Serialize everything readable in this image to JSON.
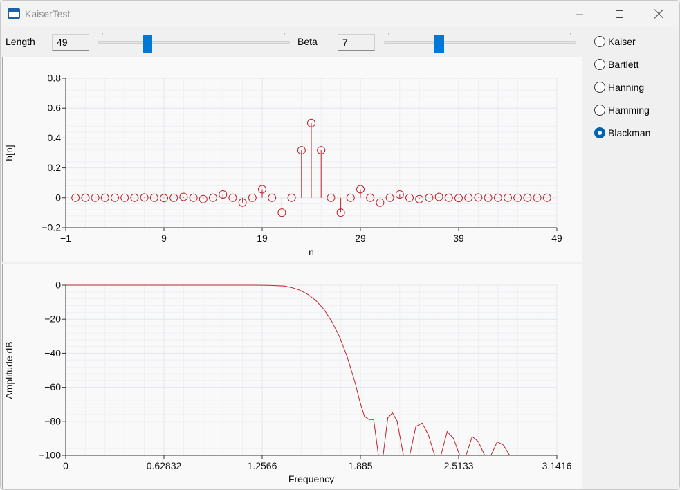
{
  "window": {
    "title": "KaiserTest"
  },
  "controls": {
    "length_label": "Length",
    "length_value": "49",
    "length_slider": {
      "min": 0,
      "max": 200,
      "value": 49
    },
    "beta_label": "Beta",
    "beta_value": "7",
    "beta_slider": {
      "min": 0,
      "max": 25,
      "value": 7
    }
  },
  "window_types": [
    {
      "label": "Kaiser",
      "selected": false
    },
    {
      "label": "Bartlett",
      "selected": false
    },
    {
      "label": "Hanning",
      "selected": false
    },
    {
      "label": "Hamming",
      "selected": false
    },
    {
      "label": "Blackman",
      "selected": true
    }
  ],
  "colors": {
    "accent": "#0078d7",
    "series": "#c0202a",
    "grid": "#e3e6ec",
    "panel": "#f9f9f9"
  },
  "chart_data": [
    {
      "type": "stem",
      "xlabel": "n",
      "ylabel": "h[n]",
      "xlim": [
        -1,
        49
      ],
      "ylim": [
        -0.2,
        0.8
      ],
      "xticks": [
        -1,
        9,
        19,
        29,
        39,
        49
      ],
      "xtick_labels": [
        "−1",
        "9",
        "19",
        "29",
        "39",
        "49"
      ],
      "yticks": [
        0.8,
        0.6,
        0.4,
        0.2,
        0,
        -0.2
      ],
      "ytick_labels": [
        "0.8",
        "0.6",
        "0.4",
        "0.2",
        "0",
        "−0.2"
      ],
      "grid": true,
      "x": [
        0,
        1,
        2,
        3,
        4,
        5,
        6,
        7,
        8,
        9,
        10,
        11,
        12,
        13,
        14,
        15,
        16,
        17,
        18,
        19,
        20,
        21,
        22,
        23,
        24,
        25,
        26,
        27,
        28,
        29,
        30,
        31,
        32,
        33,
        34,
        35,
        36,
        37,
        38,
        39,
        40,
        41,
        42,
        43,
        44,
        45,
        46,
        47,
        48
      ],
      "values": [
        0,
        0,
        0,
        0,
        0,
        0,
        0,
        0.002,
        0,
        -0.002,
        0,
        0.006,
        0,
        -0.009,
        0,
        0.022,
        0,
        -0.032,
        0,
        0.057,
        0,
        -0.099,
        0,
        0.318,
        0.5,
        0.318,
        0,
        -0.099,
        0,
        0.057,
        0,
        -0.032,
        0,
        0.022,
        0,
        -0.009,
        0,
        0.006,
        0,
        -0.002,
        0,
        0.002,
        0,
        0,
        0,
        0,
        0,
        0,
        0
      ]
    },
    {
      "type": "line",
      "xlabel": "Frequency",
      "ylabel": "Amplitude dB",
      "xlim": [
        0,
        3.1416
      ],
      "ylim": [
        -100,
        0
      ],
      "xticks": [
        0,
        0.62832,
        1.2566,
        1.885,
        2.5133,
        3.1416
      ],
      "xtick_labels": [
        "0",
        "0.62832",
        "1.2566",
        "1.885",
        "2.5133",
        "3.1416"
      ],
      "yticks": [
        0,
        -20,
        -40,
        -60,
        -80,
        -100
      ],
      "ytick_labels": [
        "0",
        "−20",
        "−40",
        "−60",
        "−80",
        "−100"
      ],
      "grid": true,
      "x": [
        0,
        0.2,
        0.4,
        0.6,
        0.8,
        1.0,
        1.2,
        1.3,
        1.4,
        1.45,
        1.5,
        1.55,
        1.6,
        1.65,
        1.7,
        1.75,
        1.8,
        1.85,
        1.88,
        1.91,
        1.94,
        1.97,
        2.0,
        2.03,
        2.06,
        2.09,
        2.12,
        2.16,
        2.2,
        2.24,
        2.28,
        2.32,
        2.36,
        2.4,
        2.44,
        2.48,
        2.52,
        2.56,
        2.6,
        2.64,
        2.68,
        2.72,
        2.76,
        2.8,
        2.84
      ],
      "values": [
        0,
        0,
        0,
        0,
        0,
        0,
        0,
        -0.1,
        -0.5,
        -1.5,
        -3,
        -5.5,
        -9,
        -14,
        -21,
        -30,
        -42,
        -57,
        -68,
        -77,
        -79,
        -79,
        -100,
        -100,
        -78,
        -75,
        -80,
        -100,
        -100,
        -83,
        -81,
        -88,
        -100,
        -100,
        -86,
        -90,
        -100,
        -100,
        -89,
        -92,
        -100,
        -100,
        -92,
        -94,
        -100
      ]
    }
  ]
}
